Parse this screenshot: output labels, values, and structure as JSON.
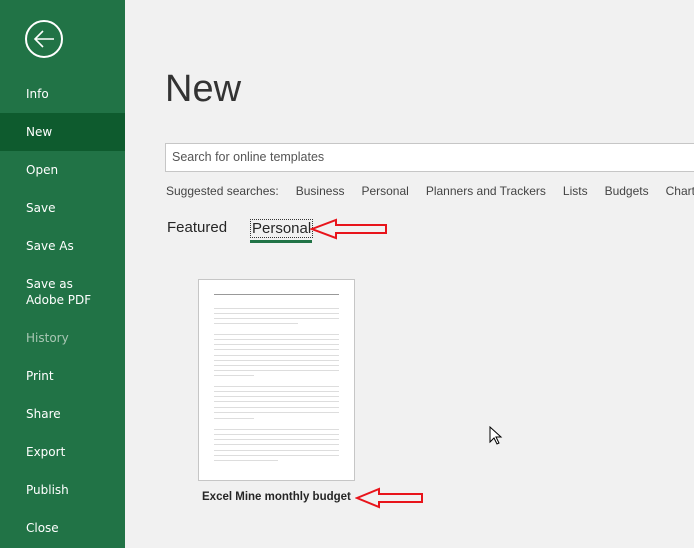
{
  "sidebar": {
    "back_icon": "arrow-left-circle-icon",
    "accent": "#217346",
    "items": [
      {
        "label": "Info"
      },
      {
        "label": "New",
        "selected": true
      },
      {
        "label": "Open"
      },
      {
        "label": "Save"
      },
      {
        "label": "Save As"
      },
      {
        "label": "Save as Adobe PDF"
      },
      {
        "label": "History",
        "disabled": true
      },
      {
        "label": "Print"
      },
      {
        "label": "Share"
      },
      {
        "label": "Export"
      },
      {
        "label": "Publish"
      },
      {
        "label": "Close"
      }
    ]
  },
  "main": {
    "title": "New",
    "search": {
      "placeholder": "Search for online templates"
    },
    "suggested": {
      "label": "Suggested searches:",
      "items": [
        "Business",
        "Personal",
        "Planners and Trackers",
        "Lists",
        "Budgets",
        "Charts"
      ]
    },
    "tabs": [
      {
        "label": "Featured"
      },
      {
        "label": "Personal",
        "selected": true
      }
    ],
    "templates": [
      {
        "name": "Excel Mine monthly budget"
      }
    ]
  },
  "annotations": {
    "arrow_color": "#e8141b"
  }
}
